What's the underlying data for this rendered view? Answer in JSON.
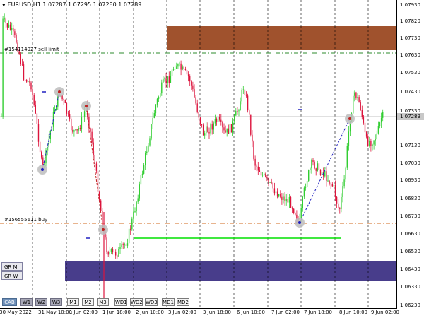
{
  "header": {
    "symbol_icon": "triangle-down-icon",
    "text": "EURUSD,H1  1.07287 1.07295 1.07280 1.07289"
  },
  "price_axis": {
    "labels": [
      "1.07930",
      "1.07820",
      "1.07730",
      "1.07630",
      "1.07530",
      "1.07430",
      "1.07330",
      "1.07289",
      "1.07130",
      "1.07030",
      "1.06930",
      "1.06830",
      "1.06730",
      "1.06630",
      "1.06530",
      "1.06430",
      "1.06330",
      "1.06230"
    ],
    "current_price": "1.07289"
  },
  "time_axis": {
    "labels": [
      "30 May 2022",
      "31 May 10:00",
      "1 Jun 02:00",
      "1 Jun 18:00",
      "2 Jun 10:00",
      "3 Jun 02:00",
      "3 Jun 18:00",
      "6 Jun 10:00",
      "7 Jun 02:00",
      "7 Jun 18:00",
      "8 Jun 10:00",
      "9 Jun 02:00"
    ]
  },
  "orders": [
    {
      "label": "#154114927 sell limit",
      "color": "#2e8b2e"
    },
    {
      "label": "#156555611 buy",
      "color": "#d2691e"
    }
  ],
  "levels": {
    "current_price_line": "1.07289",
    "sell_limit": "1.07660",
    "buy": "1.06700",
    "green_line": "1.06610"
  },
  "zones": {
    "supply_color": "#a0522d",
    "demand_color": "#483d8b"
  },
  "gr_boxes": [
    "GR M",
    "GR W"
  ],
  "timeframe_buttons": [
    {
      "label": "CAB",
      "style": "blue"
    },
    {
      "label": "W1",
      "style": "dark"
    },
    {
      "label": "W2",
      "style": "dark"
    },
    {
      "label": "W3",
      "style": "dark"
    },
    {
      "label": "M1",
      "style": "light"
    },
    {
      "label": "M2",
      "style": "light"
    },
    {
      "label": "M3",
      "style": "light"
    },
    {
      "label": "WD1",
      "style": "light"
    },
    {
      "label": "WD2",
      "style": "light"
    },
    {
      "label": "WD3",
      "style": "light"
    },
    {
      "label": "MD1",
      "style": "light"
    },
    {
      "label": "MD2",
      "style": "light"
    }
  ],
  "colors": {
    "bull": "#32cd32",
    "bear": "#dc143c",
    "grid": "#000000",
    "green_line": "#00e000"
  }
}
